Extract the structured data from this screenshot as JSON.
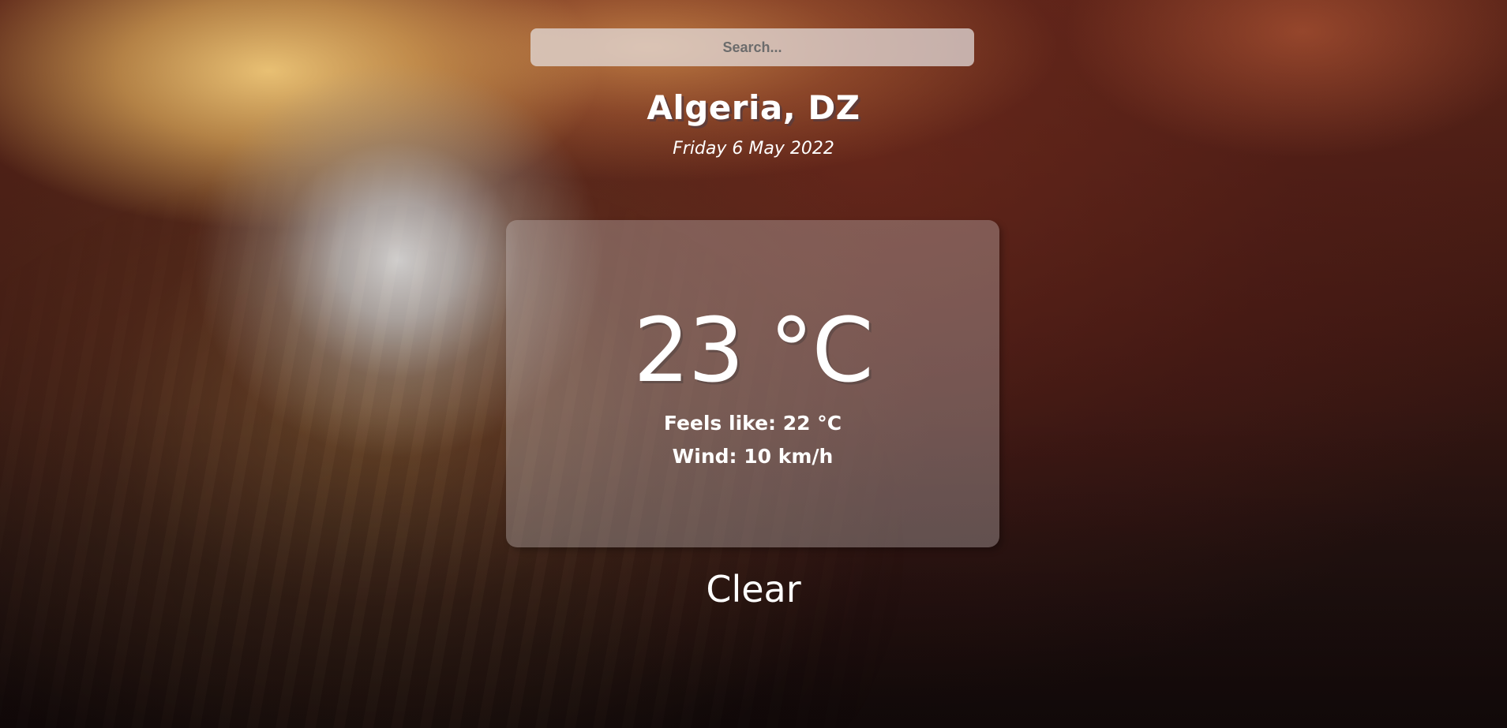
{
  "search": {
    "placeholder": "Search...",
    "value": ""
  },
  "location": {
    "name": "Algeria, DZ",
    "date": "Friday 6 May 2022"
  },
  "weather": {
    "temperature": "23 °C",
    "feels_like": "Feels like: 22 °C",
    "wind": "Wind: 10 km/h",
    "condition": "Clear"
  },
  "colors": {
    "text": "#ffffff",
    "search_background": "#e6e1e1",
    "card_background": "#c8bebe"
  }
}
